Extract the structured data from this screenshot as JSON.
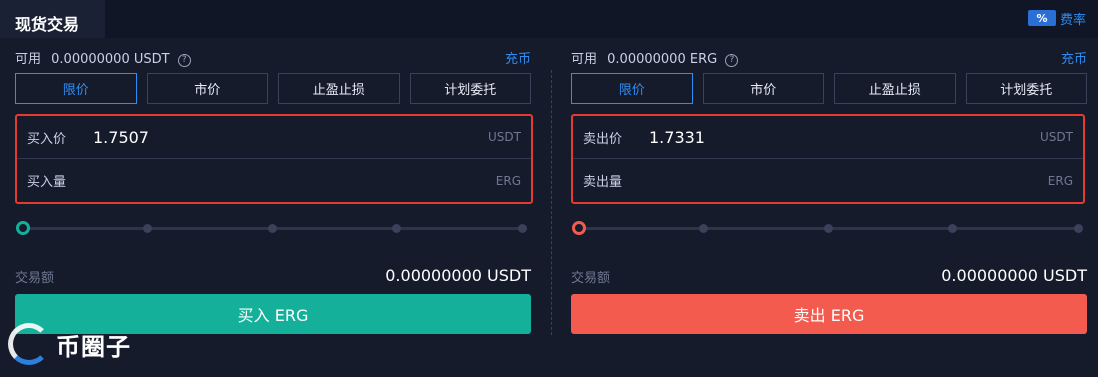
{
  "header": {
    "title": "现货交易",
    "fee_icon": "%",
    "fee_label": "费率"
  },
  "buy": {
    "available_label": "可用",
    "available_value": "0.00000000 USDT",
    "help_icon": "?",
    "deposit_label": "充币",
    "tabs": [
      {
        "label": "限价",
        "active": true
      },
      {
        "label": "市价",
        "active": false
      },
      {
        "label": "止盈止损",
        "active": false
      },
      {
        "label": "计划委托",
        "active": false
      }
    ],
    "price_label": "买入价",
    "price_value": "1.7507",
    "price_unit": "USDT",
    "qty_label": "买入量",
    "qty_value": "",
    "qty_unit": "ERG",
    "slider_level": 0,
    "amount_label": "交易额",
    "amount_value": "0.00000000 USDT",
    "button_label": "买入 ERG",
    "accent": "#15b09a"
  },
  "sell": {
    "available_label": "可用",
    "available_value": "0.00000000 ERG",
    "help_icon": "?",
    "deposit_label": "充币",
    "tabs": [
      {
        "label": "限价",
        "active": true
      },
      {
        "label": "市价",
        "active": false
      },
      {
        "label": "止盈止损",
        "active": false
      },
      {
        "label": "计划委托",
        "active": false
      }
    ],
    "price_label": "卖出价",
    "price_value": "1.7331",
    "price_unit": "USDT",
    "qty_label": "卖出量",
    "qty_value": "",
    "qty_unit": "ERG",
    "slider_level": 0,
    "amount_label": "交易额",
    "amount_value": "0.00000000 USDT",
    "button_label": "卖出 ERG",
    "accent": "#f35b4e"
  },
  "watermark": {
    "text": "币圈子"
  }
}
